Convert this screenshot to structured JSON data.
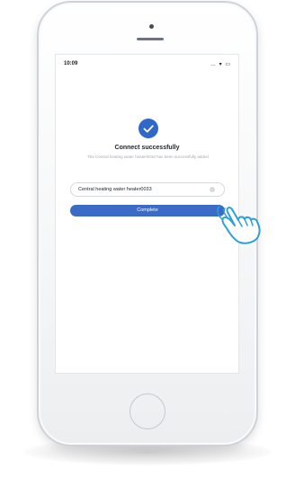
{
  "status_bar": {
    "time": "10:09",
    "icons": "… ▾ ▭"
  },
  "dialog": {
    "title": "Connect successfully",
    "message": "The Central heating water heater0033 has been successfully added",
    "device_name_value": "Central heating water heater0033",
    "complete_label": "Complete"
  },
  "colors": {
    "accent": "#3a6cc7",
    "check": "#2f68c9"
  },
  "icons": {
    "check": "check-icon",
    "clear": "clear-icon",
    "hand": "pointing-hand-icon"
  }
}
